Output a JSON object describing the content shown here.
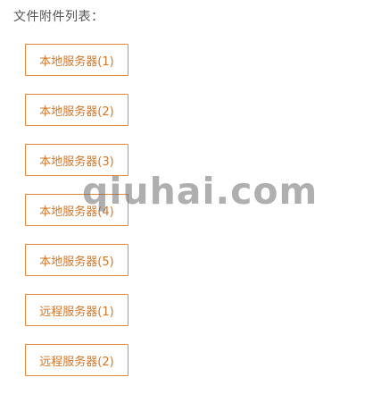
{
  "attachments": {
    "title": "文件附件列表：",
    "buttons": [
      {
        "label": "本地服务器(1)"
      },
      {
        "label": "本地服务器(2)"
      },
      {
        "label": "本地服务器(3)"
      },
      {
        "label": "本地服务器(4)"
      },
      {
        "label": "本地服务器(5)"
      },
      {
        "label": "远程服务器(1)"
      },
      {
        "label": "远程服务器(2)"
      }
    ]
  },
  "watermark": {
    "text": "qiuhai.com"
  },
  "colors": {
    "button_border": "#e08a3c",
    "button_text": "#d0772a",
    "title_text": "#555555"
  }
}
